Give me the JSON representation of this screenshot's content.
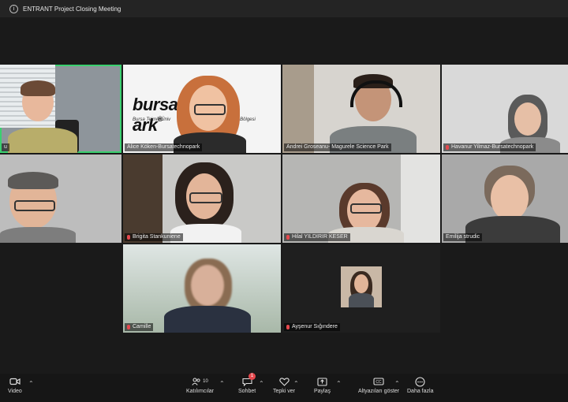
{
  "window": {
    "title": "ENTRANT Project Closing Meeting"
  },
  "participants": [
    {
      "name": "u"
    },
    {
      "name": "Alice Köken-Bursatechnopark",
      "logo": "bursatechnopark",
      "logo_visible": "bursat",
      "logo_visible_end": "ark",
      "logo_sub": "Bursa Teknik Üniv",
      "logo_sub_end": "Bölgesi"
    },
    {
      "name": "Andrei Groseanu- Magurele Science Park"
    },
    {
      "name": "Havanur Yilmaz-Bursatechnopark"
    },
    {
      "name": ""
    },
    {
      "name": "Brigita Stankuniene"
    },
    {
      "name": "Hilal YILDIRIR KESER"
    },
    {
      "name": "Emilija strudic"
    },
    {
      "name": "Camille"
    },
    {
      "name": "Ayşenur Sığındere"
    }
  ],
  "toolbar": {
    "video": "Video",
    "participants": "Katılımcılar",
    "participants_count": "10",
    "chat": "Sohbet",
    "chat_badge": "1",
    "react": "Tepki ver",
    "share": "Paylaş",
    "captions": "Altyazıları göster",
    "more": "Daha fazla"
  }
}
